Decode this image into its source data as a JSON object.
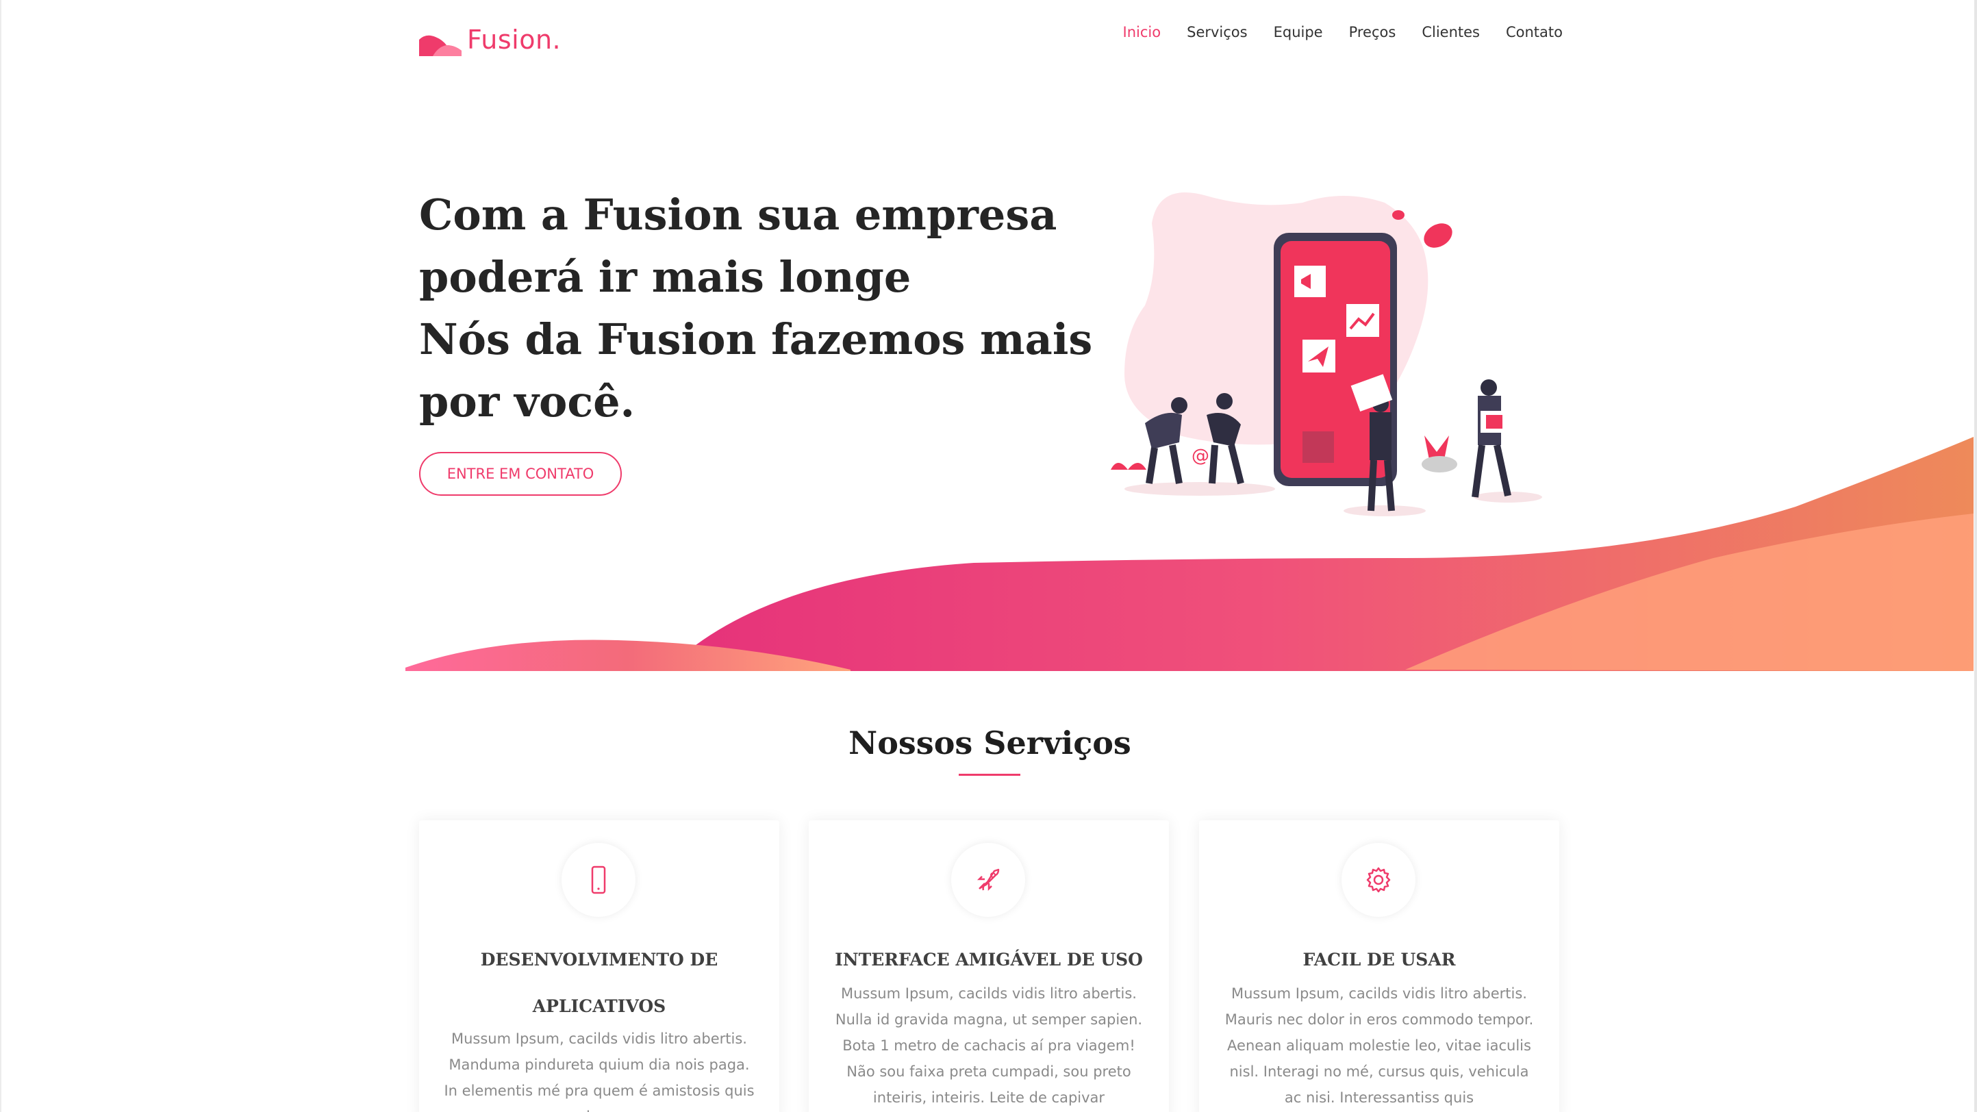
{
  "brand": {
    "name": "Fusion.",
    "color": "#ef3b6b"
  },
  "nav": {
    "items": [
      {
        "label": "Inicio",
        "active": true
      },
      {
        "label": "Serviços",
        "active": false
      },
      {
        "label": "Equipe",
        "active": false
      },
      {
        "label": "Preços",
        "active": false
      },
      {
        "label": "Clientes",
        "active": false
      },
      {
        "label": "Contato",
        "active": false
      }
    ]
  },
  "hero": {
    "lines": [
      "Com a Fusion sua empresa",
      "poderá ir mais longe",
      "Nós da Fusion fazemos mais",
      "por você."
    ],
    "cta_label": "ENTRE EM CONTATO"
  },
  "services": {
    "title": "Nossos Serviços",
    "cards": [
      {
        "icon": "smartphone-icon",
        "title": "DESENVOLVIMENTO DE APLICATIVOS",
        "text": "Mussum Ipsum, cacilds vidis litro abertis. Manduma pindureta quium dia nois paga. In elementis mé pra quem é amistosis quis leo."
      },
      {
        "icon": "rocket-icon",
        "title": "INTERFACE AMIGÁVEL DE USO",
        "text": "Mussum Ipsum, cacilds vidis litro abertis. Nulla id gravida magna, ut semper sapien. Bota 1 metro de cachacis aí pra viagem! Não sou faixa preta cumpadi, sou preto inteiris, inteiris. Leite de capivar"
      },
      {
        "icon": "gear-icon",
        "title": "FACIL DE USAR",
        "text": "Mussum Ipsum, cacilds vidis litro abertis. Mauris nec dolor in eros commodo tempor. Aenean aliquam molestie leo, vitae iaculis nisl. Interagi no mé, cursus quis, vehicula ac nisi. Interessantiss quis"
      }
    ]
  },
  "colors": {
    "accent": "#ef3b6b",
    "wave_start": "#ff5f8f",
    "wave_end": "#ffa07a",
    "text_dark": "#252525",
    "text_muted": "#8a8a8a"
  }
}
